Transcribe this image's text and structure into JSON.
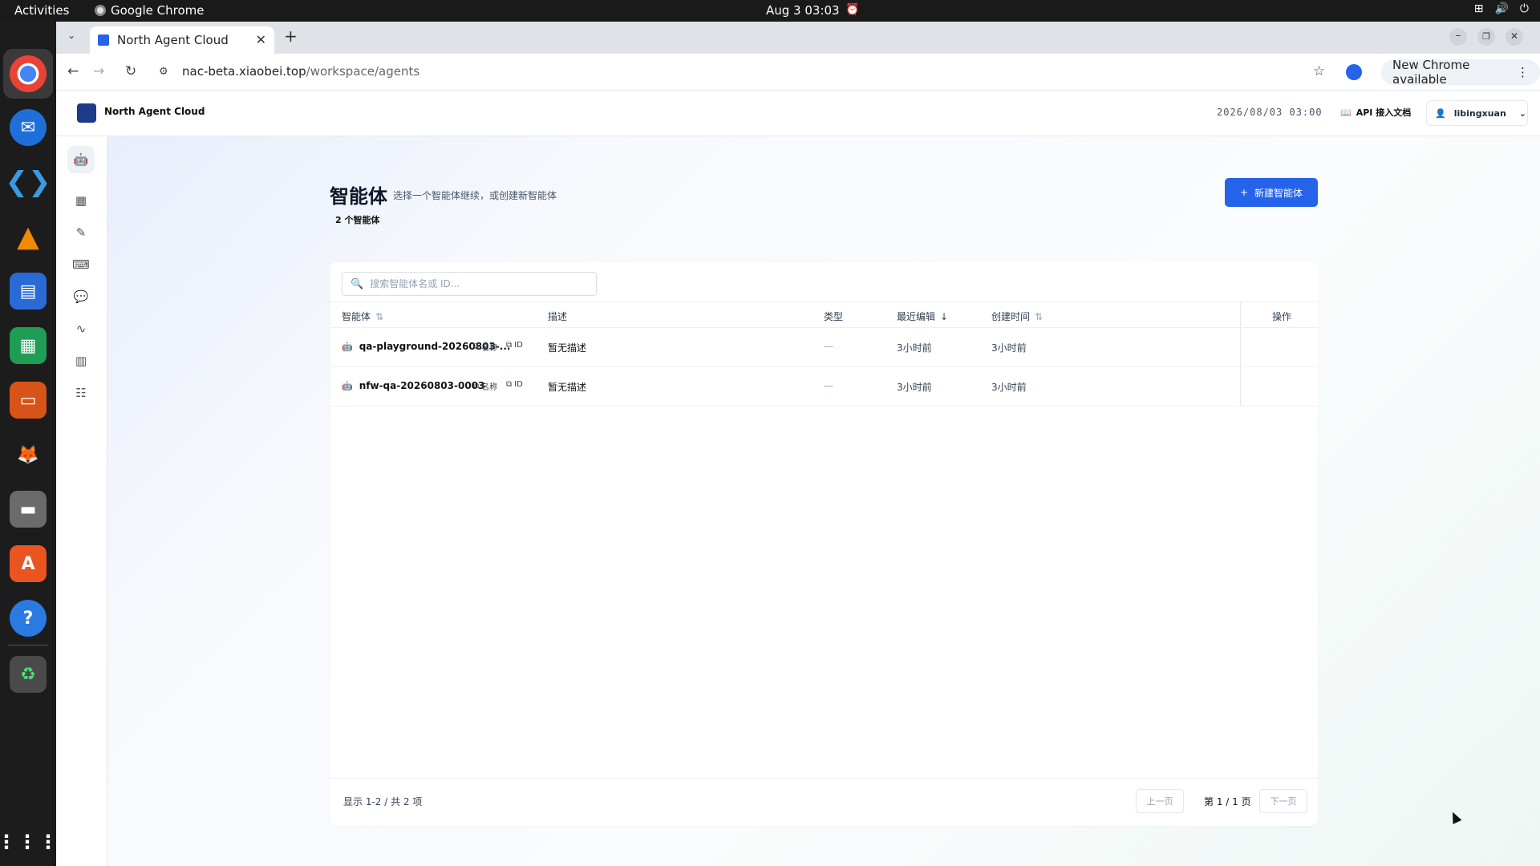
{
  "system": {
    "activities": "Activities",
    "app_name": "Google Chrome",
    "clock": "Aug 3  03:03"
  },
  "browser": {
    "tab_title": "North Agent Cloud",
    "url_host": "nac-beta.xiaobei.top",
    "url_path": "/workspace/agents",
    "new_chrome": "New Chrome available"
  },
  "header": {
    "brand": "North Agent Cloud",
    "timestamp": "2026/08/03 03:00",
    "api_docs": "API 接入文档",
    "username": "libingxuan"
  },
  "page": {
    "title": "智能体",
    "subtitle": "选择一个智能体继续，或创建新智能体",
    "count": "2 个智能体",
    "new_button": "新建智能体"
  },
  "search": {
    "placeholder": "搜索智能体名或 ID..."
  },
  "table": {
    "columns": {
      "agent": "智能体",
      "desc": "描述",
      "type": "类型",
      "edited": "最近编辑",
      "created": "创建时间",
      "actions": "操作"
    },
    "chip_name": "名称",
    "chip_id": "ID",
    "rows": [
      {
        "name": "qa-playground-20260803-...",
        "desc": "暂无描述",
        "type": "—",
        "edited": "3小时前",
        "created": "3小时前"
      },
      {
        "name": "nfw-qa-20260803-0003",
        "desc": "暂无描述",
        "type": "—",
        "edited": "3小时前",
        "created": "3小时前"
      }
    ]
  },
  "footer": {
    "info": "显示 1-2 / 共 2 项",
    "prev": "上一页",
    "page_info": "第 1 / 1 页",
    "next": "下一页"
  },
  "colors": {
    "accent": "#2563eb",
    "topbar": "#1a1a1a",
    "dock": "#1c1c1c"
  }
}
